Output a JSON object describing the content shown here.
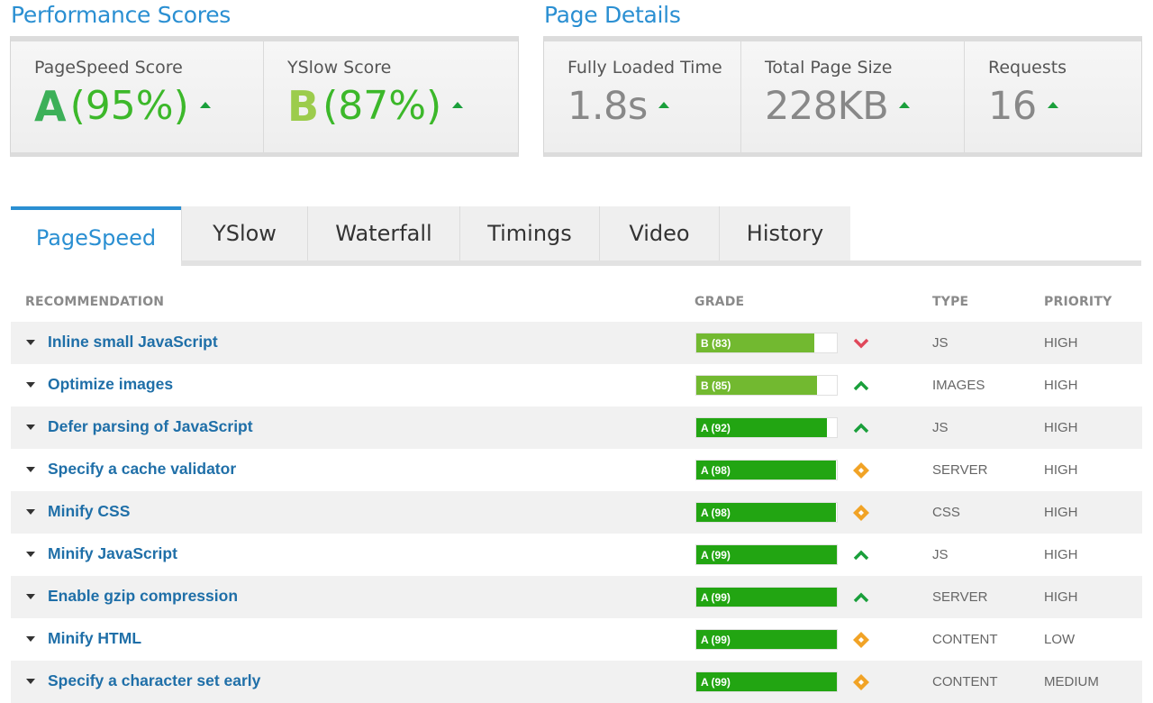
{
  "performance": {
    "title": "Performance Scores",
    "pagespeed": {
      "label": "PageSpeed Score",
      "grade": "A",
      "pct": "(95%)"
    },
    "yslow": {
      "label": "YSlow Score",
      "grade": "B",
      "pct": "(87%)"
    }
  },
  "details": {
    "title": "Page Details",
    "loaded": {
      "label": "Fully Loaded Time",
      "value": "1.8s"
    },
    "size": {
      "label": "Total Page Size",
      "value": "228KB"
    },
    "requests": {
      "label": "Requests",
      "value": "16"
    }
  },
  "tabs": [
    {
      "label": "PageSpeed"
    },
    {
      "label": "YSlow"
    },
    {
      "label": "Waterfall"
    },
    {
      "label": "Timings"
    },
    {
      "label": "Video"
    },
    {
      "label": "History"
    }
  ],
  "table": {
    "headers": {
      "recommendation": "RECOMMENDATION",
      "grade": "GRADE",
      "type": "TYPE",
      "priority": "PRIORITY"
    },
    "rows": [
      {
        "name": "Inline small JavaScript",
        "grade": "B (83)",
        "score": 83,
        "trend": "down",
        "type": "JS",
        "priority": "HIGH"
      },
      {
        "name": "Optimize images",
        "grade": "B (85)",
        "score": 85,
        "trend": "up",
        "type": "IMAGES",
        "priority": "HIGH"
      },
      {
        "name": "Defer parsing of JavaScript",
        "grade": "A (92)",
        "score": 92,
        "trend": "up",
        "type": "JS",
        "priority": "HIGH"
      },
      {
        "name": "Specify a cache validator",
        "grade": "A (98)",
        "score": 98,
        "trend": "same",
        "type": "SERVER",
        "priority": "HIGH"
      },
      {
        "name": "Minify CSS",
        "grade": "A (98)",
        "score": 98,
        "trend": "same",
        "type": "CSS",
        "priority": "HIGH"
      },
      {
        "name": "Minify JavaScript",
        "grade": "A (99)",
        "score": 99,
        "trend": "up",
        "type": "JS",
        "priority": "HIGH"
      },
      {
        "name": "Enable gzip compression",
        "grade": "A (99)",
        "score": 99,
        "trend": "up",
        "type": "SERVER",
        "priority": "HIGH"
      },
      {
        "name": "Minify HTML",
        "grade": "A (99)",
        "score": 99,
        "trend": "same",
        "type": "CONTENT",
        "priority": "LOW"
      },
      {
        "name": "Specify a character set early",
        "grade": "A (99)",
        "score": 99,
        "trend": "same",
        "type": "CONTENT",
        "priority": "MEDIUM"
      }
    ]
  },
  "colors": {
    "accent": "#2a8fd2",
    "link": "#1f6fa8",
    "grade_a_bar": "#22a512",
    "grade_b_bar": "#72b930",
    "trend_up": "#1a9f3b",
    "trend_down": "#e0485a",
    "trend_same": "#f1a326"
  }
}
